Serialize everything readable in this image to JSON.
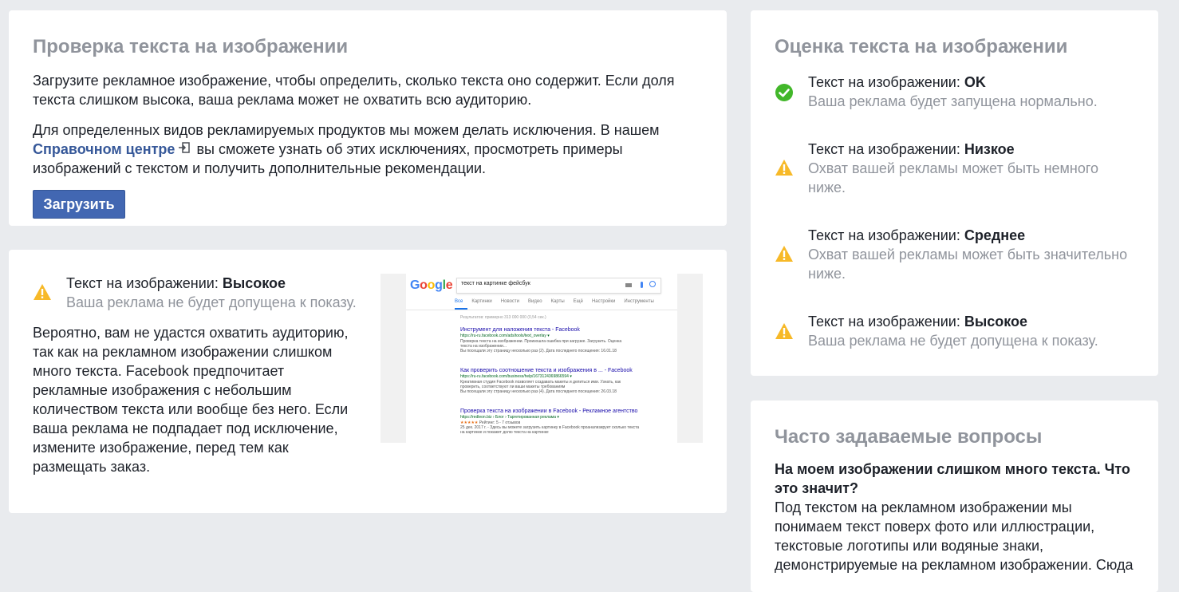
{
  "check_card": {
    "title": "Проверка текста на изображении",
    "para1_line1": "Загрузите рекламное изображение, чтобы определить, сколько текста оно содержит. Если доля",
    "para1_line2": "текста слишком высока, ваша реклама может не охватить всю аудиторию.",
    "para2_line1": "Для определенных видов рекламируемых продуктов мы можем делать исключения. В нашем",
    "help_link": "Справочном центре",
    "para2_line2_rest": "вы сможете узнать об этих исключениях, просмотреть примеры",
    "para2_line3": "изображений с текстом и получить дополнительные рекомендации.",
    "upload_button": "Загрузить"
  },
  "result_card": {
    "status_prefix": "Текст на изображении: ",
    "status_value": "Высокое",
    "status_sub": "Ваша реклама не будет допущена к показу.",
    "lines": [
      "Вероятно, вам не удастся охватить аудиторию,",
      "так как на рекламном изображении слишком",
      "много текста. Facebook предпочитает",
      "рекламные изображения с небольшим",
      "количеством текста или вообще без него. Если",
      "ваша реклама не подпадает под исключение,",
      "измените изображение, перед тем как",
      "размещать заказ."
    ],
    "example_image": {
      "search_query": "текст на картинке фейсбук",
      "tabs": [
        "Все",
        "Картинки",
        "Новости",
        "Видео",
        "Карты",
        "Ещё",
        "Настройки",
        "Инструменты"
      ],
      "results_count": "Результатов: примерно 313 000 000 (0,54 сек.)",
      "results": [
        {
          "title": "Инструмент для наложения текста - Facebook",
          "url": "https://ru-ru.facebook.com/ads/tools/text_overlay ▾",
          "snippet1": "Проверка текста на изображении. Произошла ошибка при загрузке. Загрузить. Оценка",
          "snippet2": "текста на изображении...",
          "snippet3": "Вы посещали эту страницу несколько раз (2). Дата последнего посещения: 16.01.18"
        },
        {
          "title": "Как проверить соотношение текста и изображения в ... - Facebook",
          "url": "https://ru-ru.facebook.com/business/help/1673124369866594 ▾",
          "snippet1": "Креативная студия Facebook позволяет создавать макеты и делиться ими. Узнать, как",
          "snippet2": "проверить, соответствуют ли ваши макеты требованиям",
          "snippet3": "Вы посещали эту страницу несколько раз (4). Дата последнего посещения: 26.03.18"
        },
        {
          "title": "Проверка текста на изображении в Facebook - Рекламное агентство",
          "url": "https://redleon.biz › Блог › Таргетированная реклама ▾",
          "stars": "★★★★★",
          "rating": " Рейтинг: 5 - 7 отзывов",
          "snippet1": "25 дек. 2017 г. - Здесь вы можете загрузить картинку в Facebook проанализирует сколько текста",
          "snippet2": "на картинке и покажет долю текста на картинке"
        }
      ]
    }
  },
  "rating_card": {
    "title": "Оценка текста на изображении",
    "items": [
      {
        "icon": "check-circle-icon",
        "prefix": "Текст на изображении: ",
        "value": "OK",
        "sub1": "Ваша реклама будет запущена нормально.",
        "sub2": ""
      },
      {
        "icon": "warning-icon",
        "prefix": "Текст на изображении: ",
        "value": "Низкое",
        "sub1": "Охват вашей рекламы может быть немного",
        "sub2": "ниже."
      },
      {
        "icon": "warning-icon",
        "prefix": "Текст на изображении: ",
        "value": "Среднее",
        "sub1": "Охват вашей рекламы может быть значительно",
        "sub2": "ниже."
      },
      {
        "icon": "warning-icon",
        "prefix": "Текст на изображении: ",
        "value": "Высокое",
        "sub1": "Ваша реклама не будет допущена к показу.",
        "sub2": ""
      }
    ]
  },
  "faq_card": {
    "title": "Часто задаваемые вопросы",
    "question_line1": "На моем изображении слишком много текста. Что",
    "question_line2": "это значит?",
    "answer_lines": [
      "Под текстом на рекламном изображении мы",
      "понимаем текст поверх фото или иллюстрации,",
      "текстовые логотипы или водяные знаки,",
      "демонстрируемые на рекламном изображении. Сюда"
    ]
  },
  "colors": {
    "page_bg": "#e9ebee",
    "button_blue": "#4267b2",
    "link_blue": "#365899",
    "ok_green": "#42b72a",
    "warning_yellow": "#f7b928",
    "muted_text": "#90949c"
  }
}
